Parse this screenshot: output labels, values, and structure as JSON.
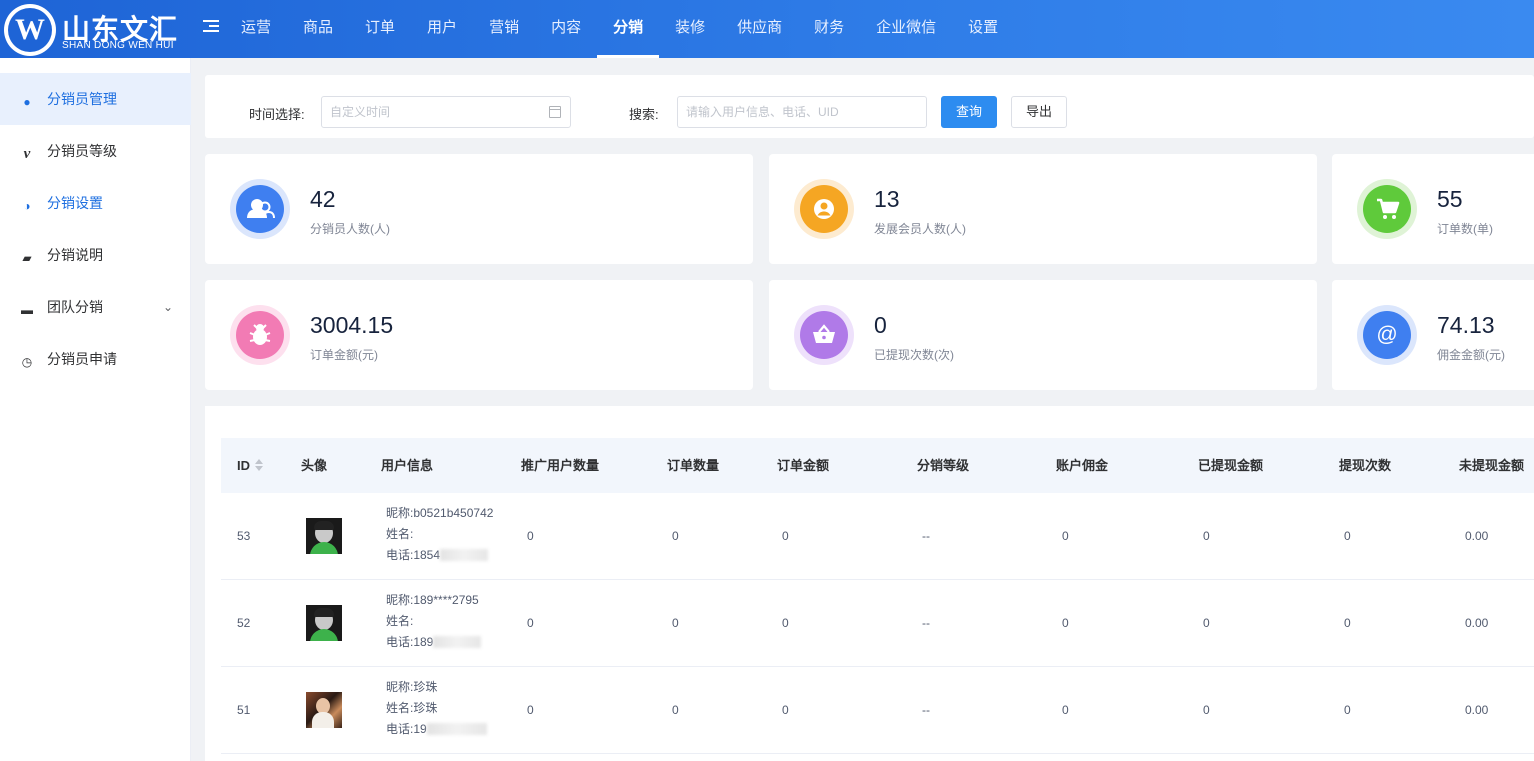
{
  "brand": {
    "logo_mark": "W",
    "name_cn": "山东文汇",
    "name_en": "SHAN DONG WEN HUI"
  },
  "nav": {
    "items": [
      {
        "label": "运营",
        "active": false
      },
      {
        "label": "商品",
        "active": false
      },
      {
        "label": "订单",
        "active": false
      },
      {
        "label": "用户",
        "active": false
      },
      {
        "label": "营销",
        "active": false
      },
      {
        "label": "内容",
        "active": false
      },
      {
        "label": "分销",
        "active": true
      },
      {
        "label": "装修",
        "active": false
      },
      {
        "label": "供应商",
        "active": false
      },
      {
        "label": "财务",
        "active": false
      },
      {
        "label": "企业微信",
        "active": false
      },
      {
        "label": "设置",
        "active": false
      }
    ]
  },
  "sidebar": {
    "items": [
      {
        "label": "分销员管理",
        "icon": "user-icon",
        "glyph": "●",
        "active": true
      },
      {
        "label": "分销员等级",
        "icon": "vimeo-icon",
        "glyph": "v",
        "active": false
      },
      {
        "label": "分销设置",
        "icon": "toggle-icon",
        "glyph": "◑",
        "active": false
      },
      {
        "label": "分销说明",
        "icon": "book-icon",
        "glyph": "▰",
        "active": false
      },
      {
        "label": "团队分销",
        "icon": "briefcase-icon",
        "glyph": "▬",
        "active": false,
        "expand": "⌄"
      },
      {
        "label": "分销员申请",
        "icon": "alarm-clock-icon",
        "glyph": "◷",
        "active": false
      }
    ]
  },
  "filter": {
    "time_label": "时间选择:",
    "time_placeholder": "自定义时间",
    "search_label": "搜索:",
    "search_placeholder": "请输入用户信息、电话、UID",
    "query_button": "查询",
    "export_button": "导出"
  },
  "stats": [
    {
      "value": "42",
      "label": "分销员人数(人)",
      "icon": "users-icon",
      "glyph": "👥",
      "color": "#3f7ff0",
      "ring": "#dbe6fc"
    },
    {
      "value": "13",
      "label": "发展会员人数(人)",
      "icon": "user-circle-icon",
      "glyph": "●",
      "color": "#f5a623",
      "ring": "#fdebd0"
    },
    {
      "value": "55",
      "label": "订单数(单)",
      "icon": "cart-icon",
      "glyph": "🛒",
      "color": "#5fca3b",
      "ring": "#dff3d6"
    },
    {
      "value": "3004.15",
      "label": "订单金额(元)",
      "icon": "bug-icon",
      "glyph": "✱",
      "color": "#f27bb4",
      "ring": "#fde0ee"
    },
    {
      "value": "0",
      "label": "已提现次数(次)",
      "icon": "basket-icon",
      "glyph": "⛉",
      "color": "#b07ae8",
      "ring": "#eee1fb"
    },
    {
      "value": "74.13",
      "label": "佣金金额(元)",
      "icon": "at-icon",
      "glyph": "@",
      "color": "#3f7ff0",
      "ring": "#dbe6fc"
    }
  ],
  "table": {
    "headers": [
      "ID",
      "头像",
      "用户信息",
      "推广用户数量",
      "订单数量",
      "订单金额",
      "分销等级",
      "账户佣金",
      "已提现金额",
      "提现次数",
      "未提现金额"
    ],
    "rows": [
      {
        "id": "53",
        "nickname": "昵称:b0521b450742",
        "name": "姓名:",
        "phone": "电话:1854",
        "promoted": "0",
        "orders": "0",
        "amount": "0",
        "level": "--",
        "commission": "0",
        "withdrawn": "0",
        "withdraw_count": "0",
        "unwithdrawn": "0.00",
        "avatar": "default"
      },
      {
        "id": "52",
        "nickname": "昵称:189****2795",
        "name": "姓名:",
        "phone": "电话:189",
        "promoted": "0",
        "orders": "0",
        "amount": "0",
        "level": "--",
        "commission": "0",
        "withdrawn": "0",
        "withdraw_count": "0",
        "unwithdrawn": "0.00",
        "avatar": "default"
      },
      {
        "id": "51",
        "nickname": "昵称:珍珠",
        "name": "姓名:珍珠",
        "phone": "电话:19",
        "promoted": "0",
        "orders": "0",
        "amount": "0",
        "level": "--",
        "commission": "0",
        "withdrawn": "0",
        "withdraw_count": "0",
        "unwithdrawn": "0.00",
        "avatar": "photo"
      }
    ]
  }
}
